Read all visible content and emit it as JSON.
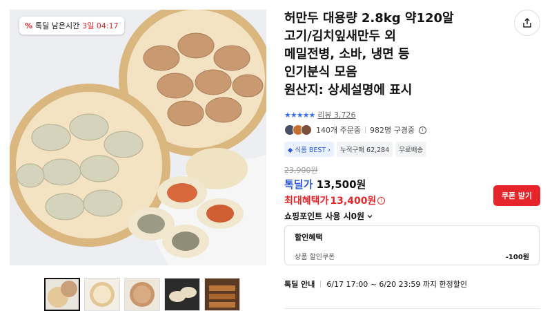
{
  "deal_badge": {
    "label": "톡딜 남은시간",
    "remaining": "3일 04:17"
  },
  "product": {
    "title_lines": [
      "허만두 대용량 2.8kg 약120알",
      "고기/김치잎새만두 외",
      "메밀전병, 소바, 냉면 등",
      "인기분식 모음",
      "원산지: 상세설명에 표시"
    ]
  },
  "rating": {
    "stars": "★★★★★",
    "review_label": "리뷰 3,726"
  },
  "buyers": {
    "ordering": "140개 주문중",
    "considering": "982명 구경중"
  },
  "chips": [
    "식품 BEST",
    "누적구매 62,284",
    "무료배송"
  ],
  "price": {
    "original": "23,900원",
    "deal_label": "톡딜가",
    "deal_price": "13,500원",
    "max_label": "최대혜택가",
    "max_price": "13,400원"
  },
  "coupon_button": "쿠폰 받기",
  "points_text": "쇼핑포인트 사용 시0원",
  "benefit": {
    "title": "할인혜택",
    "item_label": "상품 할인쿠폰",
    "item_amount": "-100원"
  },
  "deal_info": {
    "label": "톡딜 안내",
    "period": "6/17 17:00 ~ 6/20 23:59 까지 한정할인"
  },
  "icons": {
    "share": "share-icon",
    "percent": "percent-icon",
    "info": "info-icon",
    "chevron": "chevron-down-icon"
  },
  "colors": {
    "accent_red": "#e5252a",
    "accent_blue": "#2d5bd7"
  }
}
